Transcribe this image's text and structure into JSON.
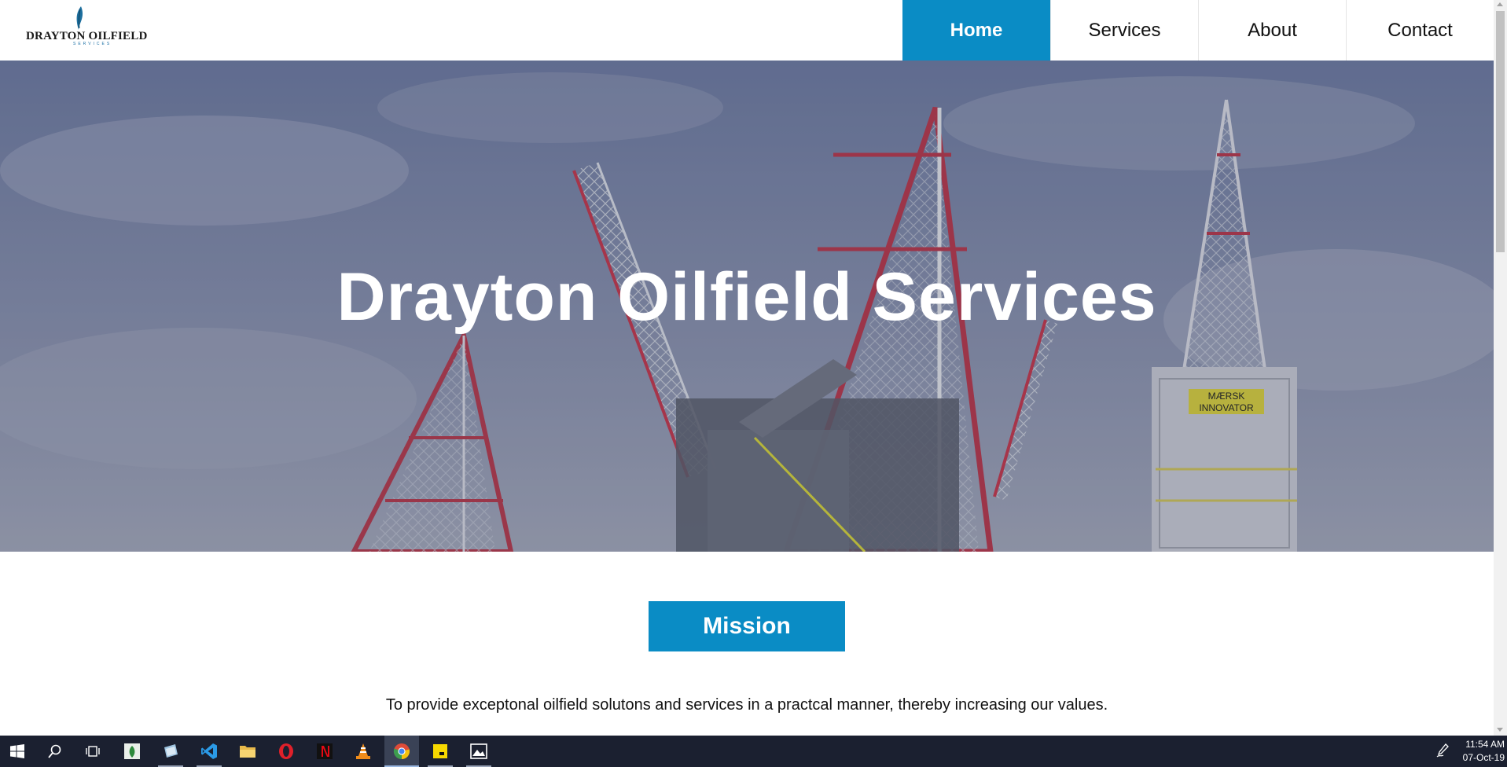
{
  "site": {
    "logo": {
      "name": "DRAYTON OILFIELD",
      "sub": "SERVICES"
    },
    "nav": [
      {
        "label": "Home",
        "active": true
      },
      {
        "label": "Services",
        "active": false
      },
      {
        "label": "About",
        "active": false
      },
      {
        "label": "Contact",
        "active": false
      }
    ],
    "hero": {
      "title": "Drayton Oilfield Services",
      "sign_line1": "MÆRSK",
      "sign_line2": "INNOVATOR"
    },
    "mission": {
      "button_label": "Mission",
      "text": "To provide exceptonal oilfield solutons and services in a practcal manner, thereby increasing our values."
    },
    "accent_color": "#0a8cc5"
  },
  "taskbar": {
    "icons": [
      "windows-start-icon",
      "search-icon",
      "task-view-icon",
      "sheets-app-icon",
      "paint-app-icon",
      "vscode-icon",
      "file-explorer-icon",
      "opera-icon",
      "netflix-icon",
      "vlc-icon",
      "chrome-icon",
      "sticky-notes-icon",
      "photos-icon"
    ],
    "time": "11:54 AM",
    "date": "07-Oct-19"
  }
}
